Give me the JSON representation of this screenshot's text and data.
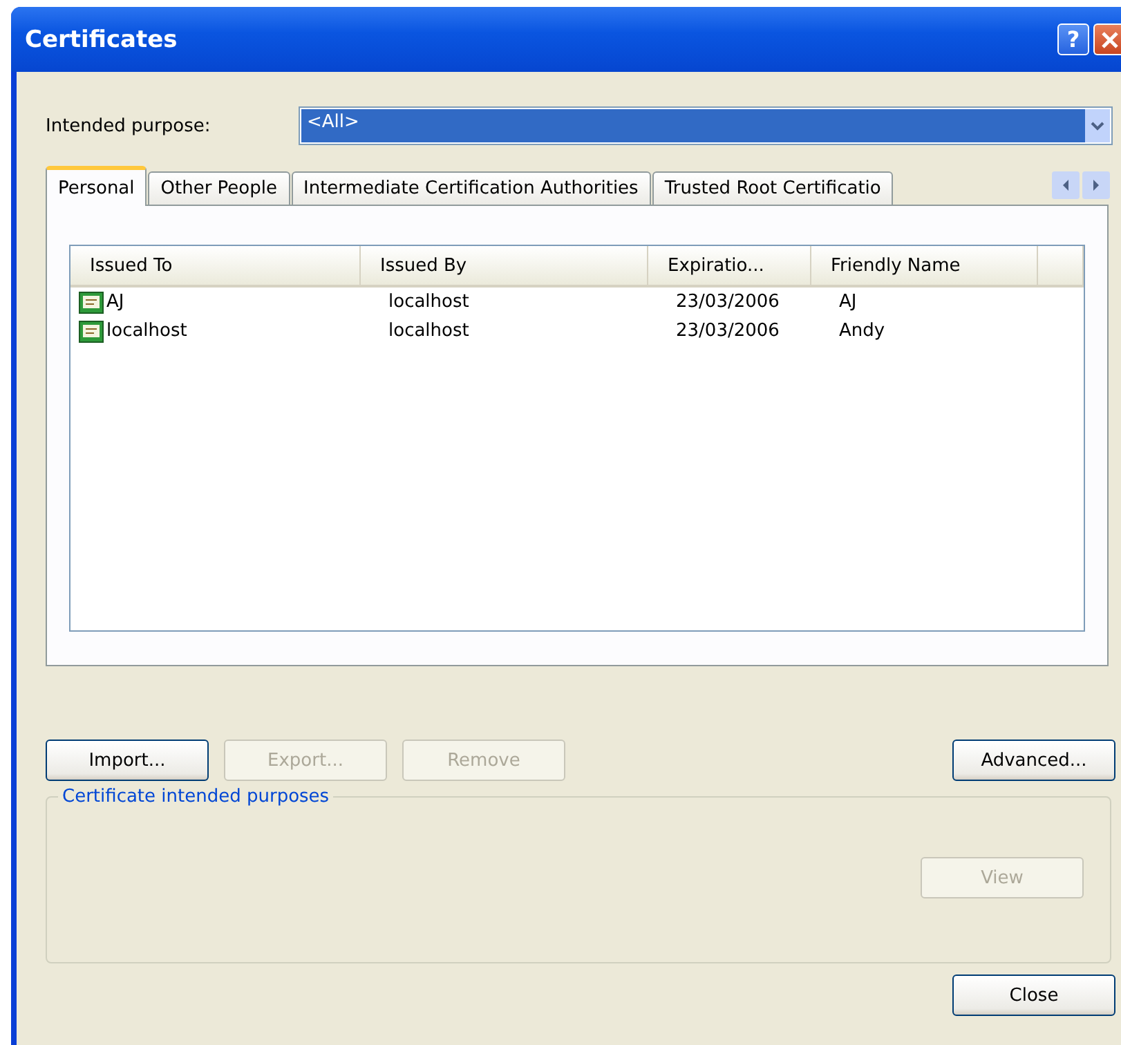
{
  "window": {
    "title": "Certificates",
    "help_button": "?"
  },
  "intended_purpose": {
    "label": "Intended purpose:",
    "value": "<All>"
  },
  "tabs": [
    {
      "label": "Personal",
      "selected": true
    },
    {
      "label": "Other People",
      "selected": false
    },
    {
      "label": "Intermediate Certification Authorities",
      "selected": false
    },
    {
      "label": "Trusted Root Certificatio",
      "selected": false
    }
  ],
  "table": {
    "columns": [
      "Issued To",
      "Issued By",
      "Expiratio...",
      "Friendly Name"
    ],
    "rows": [
      {
        "cells": [
          "AJ",
          "localhost",
          "23/03/2006",
          "AJ"
        ],
        "selected": false
      },
      {
        "cells": [
          "localhost",
          "localhost",
          "23/03/2006",
          "Andy"
        ],
        "selected": false
      }
    ]
  },
  "buttons": [
    {
      "label": "Import...",
      "disabled": false
    },
    {
      "label": "Export...",
      "disabled": true
    },
    {
      "label": "Remove",
      "disabled": true
    },
    {
      "label": "Advanced...",
      "disabled": false
    }
  ],
  "purposes_group": {
    "title": "Certificate intended purposes",
    "view_button": {
      "label": "View",
      "disabled": true
    }
  },
  "close_button": {
    "label": "Close",
    "disabled": false
  }
}
